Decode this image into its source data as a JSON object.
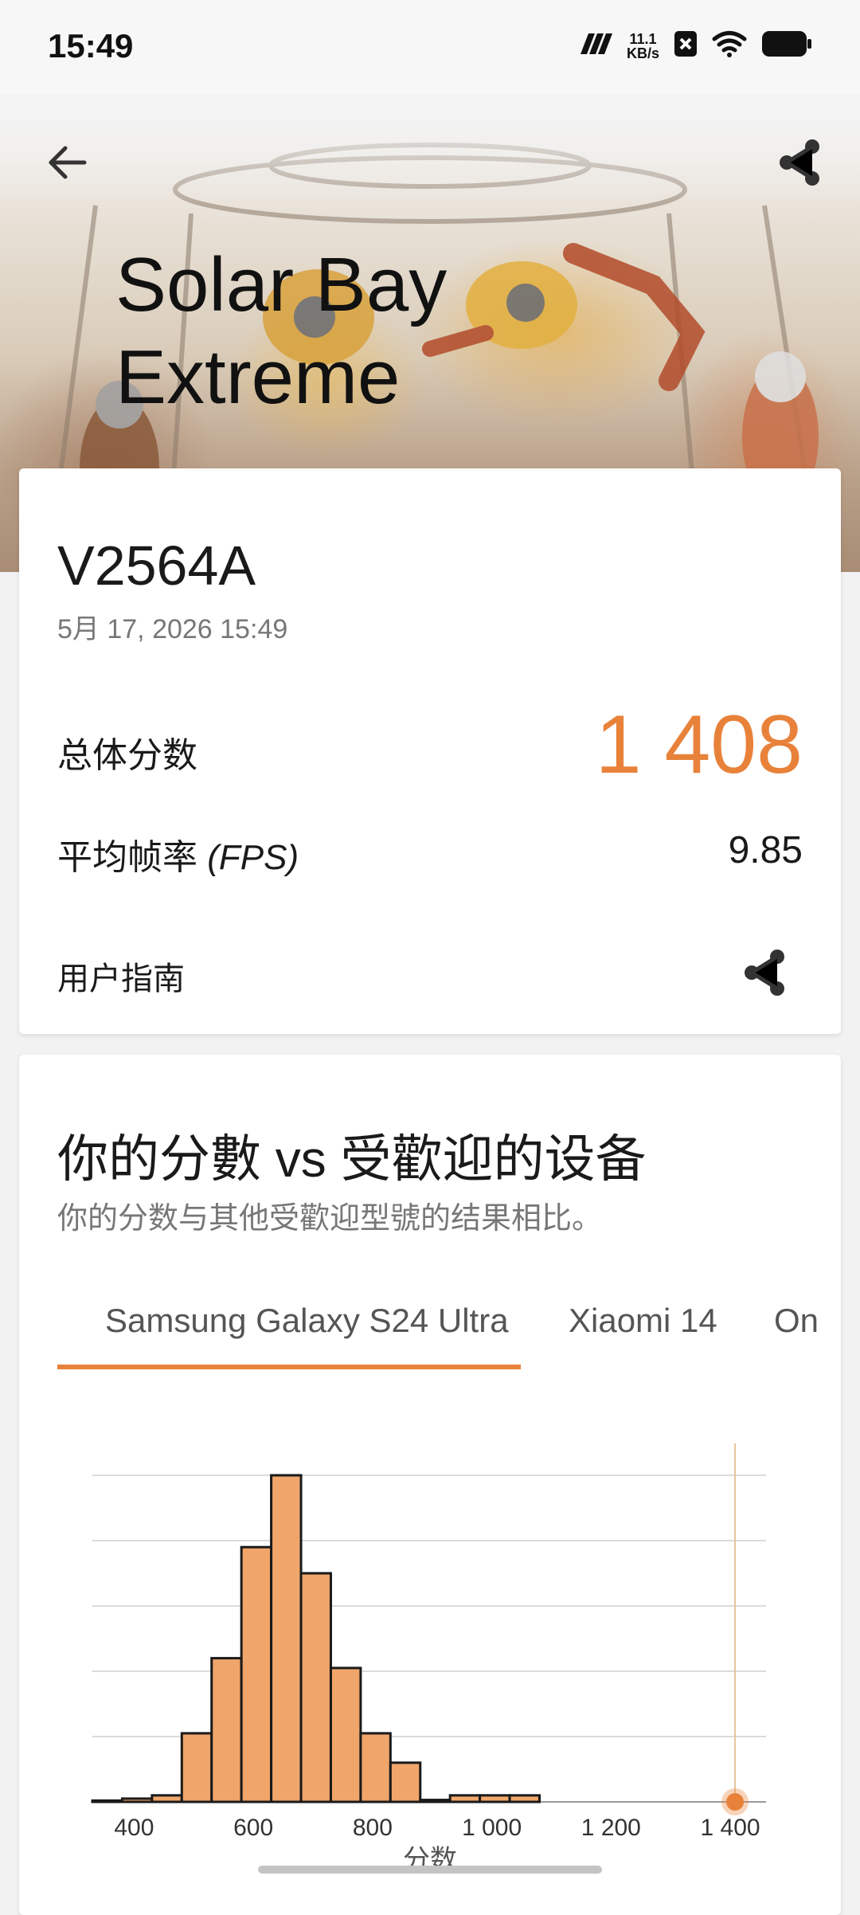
{
  "status_bar": {
    "time": "15:49",
    "net_speed_value": "11.1",
    "net_speed_unit": "KB/s",
    "icons": [
      "signal-icon",
      "network-speed",
      "notification-x-icon",
      "wifi-icon",
      "battery-icon"
    ]
  },
  "header": {
    "title_line1": "Solar Bay",
    "title_line2": "Extreme",
    "icons": {
      "back": "back-arrow-icon",
      "share": "share-icon"
    }
  },
  "result": {
    "device": "V2564A",
    "timestamp": "5月 17, 2026 15:49",
    "overall_score_label": "总体分数",
    "overall_score": "1 408",
    "fps_label_cn": "平均帧率",
    "fps_label_en": "(FPS)",
    "fps_value": "9.85",
    "user_guide": "用户指南"
  },
  "comparison": {
    "title": "你的分數 vs 受歡迎的设备",
    "subtitle": "你的分数与其他受歡迎型號的结果相比。",
    "tabs": [
      "Samsung Galaxy S24 Ultra",
      "Xiaomi 14",
      "On"
    ],
    "active_tab": 0
  },
  "colors": {
    "accent": "#e8823a",
    "bar_fill": "#f0a56a",
    "bar_stroke": "#1a1a1a",
    "marker_line": "#e6c49a"
  },
  "chart_data": {
    "type": "bar",
    "xlabel": "分数",
    "ylabel": "",
    "xlim": [
      330,
      1460
    ],
    "ylim": [
      0,
      5
    ],
    "grid": true,
    "x_ticks": [
      400,
      600,
      800,
      1000,
      1200,
      1400
    ],
    "x_tick_labels": [
      "400",
      "600",
      "800",
      "1 000",
      "1 200",
      "1 400"
    ],
    "bins": [
      {
        "start": 330,
        "end": 380,
        "value": 0.02
      },
      {
        "start": 380,
        "end": 430,
        "value": 0.05
      },
      {
        "start": 430,
        "end": 480,
        "value": 0.1
      },
      {
        "start": 480,
        "end": 530,
        "value": 1.05
      },
      {
        "start": 530,
        "end": 580,
        "value": 2.2
      },
      {
        "start": 580,
        "end": 630,
        "value": 3.9
      },
      {
        "start": 630,
        "end": 680,
        "value": 5.0
      },
      {
        "start": 680,
        "end": 730,
        "value": 3.5
      },
      {
        "start": 730,
        "end": 780,
        "value": 2.05
      },
      {
        "start": 780,
        "end": 830,
        "value": 1.05
      },
      {
        "start": 830,
        "end": 880,
        "value": 0.6
      },
      {
        "start": 880,
        "end": 930,
        "value": 0.03
      },
      {
        "start": 930,
        "end": 980,
        "value": 0.1
      },
      {
        "start": 980,
        "end": 1030,
        "value": 0.1
      },
      {
        "start": 1030,
        "end": 1080,
        "value": 0.1
      }
    ],
    "marker": {
      "x": 1408
    }
  }
}
